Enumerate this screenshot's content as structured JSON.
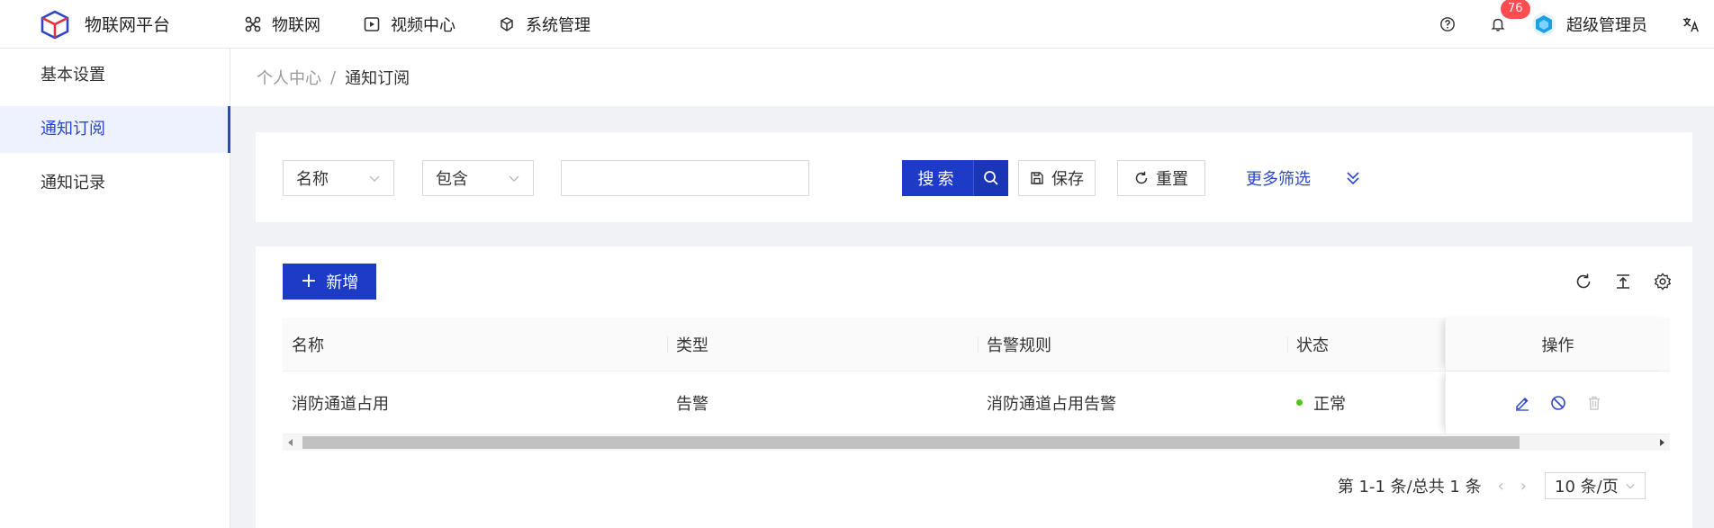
{
  "header": {
    "app_title": "物联网平台",
    "nav": [
      {
        "label": "物联网",
        "icon": "grid-icon"
      },
      {
        "label": "视频中心",
        "icon": "play-icon"
      },
      {
        "label": "系统管理",
        "icon": "cube-icon"
      }
    ],
    "notification_count": "76",
    "user_name": "超级管理员",
    "icons": [
      "help-icon",
      "bell-icon",
      "avatar",
      "translate-icon"
    ]
  },
  "sidebar": {
    "items": [
      {
        "label": "基本设置",
        "active": false
      },
      {
        "label": "通知订阅",
        "active": true
      },
      {
        "label": "通知记录",
        "active": false
      }
    ]
  },
  "breadcrumb": {
    "parent": "个人中心",
    "separator": "/",
    "current": "通知订阅"
  },
  "filter": {
    "field_select": "名称",
    "operator_select": "包含",
    "value_input": "",
    "search_label": "搜索",
    "save_label": "保存",
    "reset_label": "重置",
    "more_filter_label": "更多筛选"
  },
  "toolbar": {
    "add_label": "新增",
    "icons": [
      "refresh-icon",
      "export-icon",
      "settings-icon"
    ]
  },
  "table": {
    "columns": [
      "名称",
      "类型",
      "告警规则",
      "状态",
      "操作"
    ],
    "rows": [
      {
        "name": "消防通道占用",
        "type": "告警",
        "rule": "消防通道占用告警",
        "status": "正常",
        "status_color": "#52c41a",
        "actions": [
          "edit-icon",
          "disable-icon",
          "delete-icon"
        ]
      }
    ]
  },
  "pagination": {
    "summary": "第 1-1 条/总共 1 条",
    "page_size": "10 条/页"
  },
  "colors": {
    "primary": "#1d3bc7",
    "badge": "#ff4d4f",
    "status_ok": "#52c41a"
  }
}
